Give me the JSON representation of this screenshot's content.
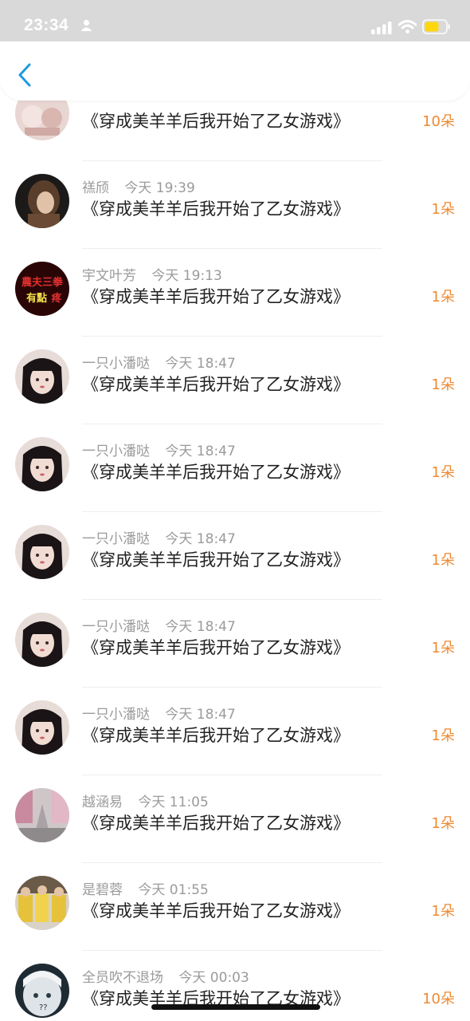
{
  "status_bar": {
    "time": "23:34"
  },
  "nav": {
    "back_icon": "chevron-left-icon"
  },
  "colors": {
    "accent": "#1e9be0",
    "amount": "#ef8a32",
    "meta": "#9b9b9b"
  },
  "gifts": [
    {
      "name": "",
      "time": "",
      "title": "《穿成美羊羊后我开始了乙女游戏》",
      "amount": "10朵"
    },
    {
      "name": "禚颀",
      "time": "今天 19:39",
      "title": "《穿成美羊羊后我开始了乙女游戏》",
      "amount": "1朵"
    },
    {
      "name": "宇文叶芳",
      "time": "今天 19:13",
      "title": "《穿成美羊羊后我开始了乙女游戏》",
      "amount": "1朵",
      "avatar_text": [
        "農夫三拳",
        "有點",
        "疼"
      ]
    },
    {
      "name": "一只小潘哒",
      "time": "今天 18:47",
      "title": "《穿成美羊羊后我开始了乙女游戏》",
      "amount": "1朵"
    },
    {
      "name": "一只小潘哒",
      "time": "今天 18:47",
      "title": "《穿成美羊羊后我开始了乙女游戏》",
      "amount": "1朵"
    },
    {
      "name": "一只小潘哒",
      "time": "今天 18:47",
      "title": "《穿成美羊羊后我开始了乙女游戏》",
      "amount": "1朵"
    },
    {
      "name": "一只小潘哒",
      "time": "今天 18:47",
      "title": "《穿成美羊羊后我开始了乙女游戏》",
      "amount": "1朵"
    },
    {
      "name": "一只小潘哒",
      "time": "今天 18:47",
      "title": "《穿成美羊羊后我开始了乙女游戏》",
      "amount": "1朵"
    },
    {
      "name": "越涵易",
      "time": "今天 11:05",
      "title": "《穿成美羊羊后我开始了乙女游戏》",
      "amount": "1朵"
    },
    {
      "name": "是碧蓉",
      "time": "今天 01:55",
      "title": "《穿成美羊羊后我开始了乙女游戏》",
      "amount": "1朵"
    },
    {
      "name": "全员吹不退场",
      "time": "今天 00:03",
      "title": "《穿成美羊羊后我开始了乙女游戏》",
      "amount": "10朵"
    }
  ]
}
